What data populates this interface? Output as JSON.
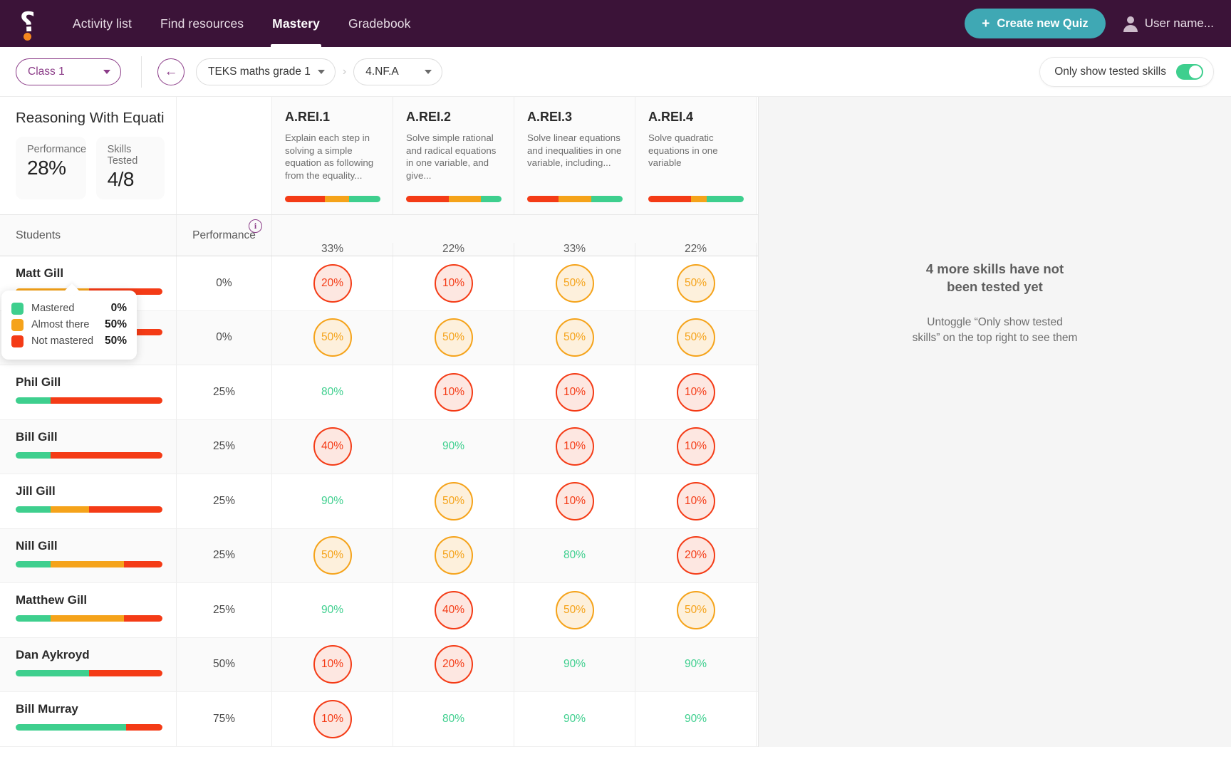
{
  "nav": {
    "logo_name": "quizalize-logo",
    "links": [
      {
        "label": "Activity list",
        "active": false
      },
      {
        "label": "Find resources",
        "active": false
      },
      {
        "label": "Mastery",
        "active": true
      },
      {
        "label": "Gradebook",
        "active": false
      }
    ],
    "create_button": "Create new Quiz",
    "user_label": "User name..."
  },
  "filters": {
    "class_select": "Class 1",
    "curriculum_select": "TEKS maths grade 1",
    "standard_select": "4.NF.A",
    "breadcrumb_separator": "›",
    "toggle_label": "Only show tested skills",
    "toggle_on": true
  },
  "summary": {
    "title": "Reasoning With Equations And...",
    "performance_label": "Performance",
    "performance_value": "28%",
    "skills_label": "Skills Tested",
    "skills_value": "4/8"
  },
  "table": {
    "students_header": "Students",
    "performance_header": "Performance",
    "columns": [
      {
        "code": "A.REI.1",
        "description": "Explain each step in solving a simple equation as following from the equality...",
        "percent": "33%",
        "bar": [
          {
            "color": "#F43B16",
            "pct": 42
          },
          {
            "color": "#F5A31A",
            "pct": 25
          },
          {
            "color": "#3ECF8E",
            "pct": 33
          }
        ]
      },
      {
        "code": "A.REI.2",
        "description": "Solve simple rational and radical equations in one variable, and give...",
        "percent": "22%",
        "bar": [
          {
            "color": "#F43B16",
            "pct": 45
          },
          {
            "color": "#F5A31A",
            "pct": 33
          },
          {
            "color": "#3ECF8E",
            "pct": 22
          }
        ]
      },
      {
        "code": "A.REI.3",
        "description": "Solve linear equations and inequalities in one variable, including...",
        "percent": "33%",
        "bar": [
          {
            "color": "#F43B16",
            "pct": 33
          },
          {
            "color": "#F5A31A",
            "pct": 34
          },
          {
            "color": "#3ECF8E",
            "pct": 33
          }
        ]
      },
      {
        "code": "A.REI.4",
        "description": "Solve quadratic equations in one variable",
        "percent": "22%",
        "bar": [
          {
            "color": "#F43B16",
            "pct": 45
          },
          {
            "color": "#F5A31A",
            "pct": 16
          },
          {
            "color": "#3ECF8E",
            "pct": 39
          }
        ]
      }
    ],
    "rows": [
      {
        "name": "Matt Gill",
        "performance": "0%",
        "bar": [
          {
            "color": "#F5A31A",
            "pct": 50
          },
          {
            "color": "#F43B16",
            "pct": 50
          }
        ],
        "scores": [
          {
            "value": "20%",
            "style": "red"
          },
          {
            "value": "10%",
            "style": "red"
          },
          {
            "value": "50%",
            "style": "orange"
          },
          {
            "value": "50%",
            "style": "orange"
          }
        ]
      },
      {
        "name": "",
        "performance": "0%",
        "bar": [
          {
            "color": "#F5A31A",
            "pct": 50
          },
          {
            "color": "#F43B16",
            "pct": 50
          }
        ],
        "scores": [
          {
            "value": "50%",
            "style": "orange"
          },
          {
            "value": "50%",
            "style": "orange"
          },
          {
            "value": "50%",
            "style": "orange"
          },
          {
            "value": "50%",
            "style": "orange"
          }
        ]
      },
      {
        "name": "Phil Gill",
        "performance": "25%",
        "bar": [
          {
            "color": "#3ECF8E",
            "pct": 24
          },
          {
            "color": "#F43B16",
            "pct": 76
          }
        ],
        "scores": [
          {
            "value": "80%",
            "style": "green"
          },
          {
            "value": "10%",
            "style": "red"
          },
          {
            "value": "10%",
            "style": "red"
          },
          {
            "value": "10%",
            "style": "red"
          }
        ]
      },
      {
        "name": "Bill Gill",
        "performance": "25%",
        "bar": [
          {
            "color": "#3ECF8E",
            "pct": 24
          },
          {
            "color": "#F43B16",
            "pct": 76
          }
        ],
        "scores": [
          {
            "value": "40%",
            "style": "red"
          },
          {
            "value": "90%",
            "style": "green"
          },
          {
            "value": "10%",
            "style": "red"
          },
          {
            "value": "10%",
            "style": "red"
          }
        ]
      },
      {
        "name": "Jill Gill",
        "performance": "25%",
        "bar": [
          {
            "color": "#3ECF8E",
            "pct": 24
          },
          {
            "color": "#F5A31A",
            "pct": 26
          },
          {
            "color": "#F43B16",
            "pct": 50
          }
        ],
        "scores": [
          {
            "value": "90%",
            "style": "green"
          },
          {
            "value": "50%",
            "style": "orange"
          },
          {
            "value": "10%",
            "style": "red"
          },
          {
            "value": "10%",
            "style": "red"
          }
        ]
      },
      {
        "name": "Nill Gill",
        "performance": "25%",
        "bar": [
          {
            "color": "#3ECF8E",
            "pct": 24
          },
          {
            "color": "#F5A31A",
            "pct": 50
          },
          {
            "color": "#F43B16",
            "pct": 26
          }
        ],
        "scores": [
          {
            "value": "50%",
            "style": "orange"
          },
          {
            "value": "50%",
            "style": "orange"
          },
          {
            "value": "80%",
            "style": "green"
          },
          {
            "value": "20%",
            "style": "red"
          }
        ]
      },
      {
        "name": "Matthew Gill",
        "performance": "25%",
        "bar": [
          {
            "color": "#3ECF8E",
            "pct": 24
          },
          {
            "color": "#F5A31A",
            "pct": 50
          },
          {
            "color": "#F43B16",
            "pct": 26
          }
        ],
        "scores": [
          {
            "value": "90%",
            "style": "green"
          },
          {
            "value": "40%",
            "style": "red"
          },
          {
            "value": "50%",
            "style": "orange"
          },
          {
            "value": "50%",
            "style": "orange"
          }
        ]
      },
      {
        "name": "Dan Aykroyd",
        "performance": "50%",
        "bar": [
          {
            "color": "#3ECF8E",
            "pct": 50
          },
          {
            "color": "#F43B16",
            "pct": 50
          }
        ],
        "scores": [
          {
            "value": "10%",
            "style": "red"
          },
          {
            "value": "20%",
            "style": "red"
          },
          {
            "value": "90%",
            "style": "green"
          },
          {
            "value": "90%",
            "style": "green"
          }
        ]
      },
      {
        "name": "Bill Murray",
        "performance": "75%",
        "bar": [
          {
            "color": "#3ECF8E",
            "pct": 75
          },
          {
            "color": "#F43B16",
            "pct": 25
          }
        ],
        "scores": [
          {
            "value": "10%",
            "style": "red"
          },
          {
            "value": "80%",
            "style": "green"
          },
          {
            "value": "90%",
            "style": "green"
          },
          {
            "value": "90%",
            "style": "green"
          }
        ]
      }
    ]
  },
  "tooltip": {
    "items": [
      {
        "label": "Mastered",
        "value": "0%",
        "color": "#3ECF8E"
      },
      {
        "label": "Almost there",
        "value": "50%",
        "color": "#F5A31A"
      },
      {
        "label": "Not mastered",
        "value": "50%",
        "color": "#F43B16"
      }
    ]
  },
  "side_panel": {
    "title": "4 more skills have not been tested yet",
    "subtitle": "Untoggle “Only show tested skills” on the top right to see them"
  },
  "colors": {
    "brand_purple": "#3B1338",
    "accent_purple": "#8B3C88",
    "teal": "#3FA8B4",
    "mastered": "#3ECF8E",
    "almost": "#F5A31A",
    "not_mastered": "#F43B16"
  }
}
